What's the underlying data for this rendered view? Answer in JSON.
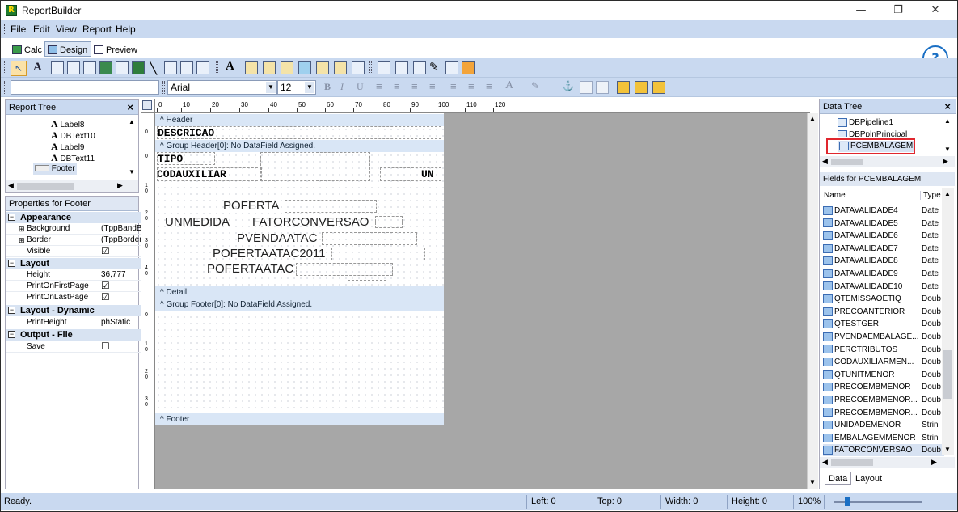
{
  "window": {
    "title": "ReportBuilder",
    "icon_letter": "R",
    "min": "—",
    "restore": "❐",
    "close": "✕"
  },
  "menu": [
    "File",
    "Edit",
    "View",
    "Report",
    "Help"
  ],
  "tabs": [
    "Calc",
    "Design",
    "Preview"
  ],
  "font": {
    "name": "Arial",
    "size": "12"
  },
  "report_tree": {
    "title": "Report Tree",
    "items": [
      "Label8",
      "DBText10",
      "Label9",
      "DBText11",
      "Footer"
    ]
  },
  "properties": {
    "title": "Properties for Footer",
    "categories": [
      {
        "name": "Appearance",
        "rows": [
          {
            "name": "Background",
            "value": "(TppBandBa",
            "expand": "⊞"
          },
          {
            "name": "Border",
            "value": "(TppBorder",
            "expand": "⊞"
          },
          {
            "name": "Visible",
            "value": "☑"
          }
        ]
      },
      {
        "name": "Layout",
        "rows": [
          {
            "name": "Height",
            "value": "36,777"
          },
          {
            "name": "PrintOnFirstPage",
            "value": "☑"
          },
          {
            "name": "PrintOnLastPage",
            "value": "☑"
          }
        ]
      },
      {
        "name": "Layout - Dynamic",
        "rows": [
          {
            "name": "PrintHeight",
            "value": "phStatic"
          }
        ]
      },
      {
        "name": "Output - File",
        "rows": [
          {
            "name": "Save",
            "value": "☐"
          }
        ]
      }
    ]
  },
  "ruler": [
    "0",
    "10",
    "20",
    "30",
    "40",
    "50",
    "60",
    "70",
    "80",
    "90",
    "100",
    "110",
    "120"
  ],
  "design": {
    "bands": {
      "header": "^ Header",
      "group_header": "^ Group Header[0]: No DataField Assigned.",
      "detail": "^ Detail",
      "group_footer": "^ Group Footer[0]: No DataField Assigned.",
      "footer": "^ Footer"
    },
    "descricao": "DESCRICAO",
    "tipo": "TIPO",
    "codauxiliar": "CODAUXILIAR",
    "un": "UN",
    "poferta": "POFERTA",
    "unmedida": "UNMEDIDA",
    "fatorconversao": "FATORCONVERSAO",
    "pvendaatac": "PVENDAATAC",
    "pofertaatac2011": "POFERTAATAC2011",
    "pofertaatac": "POFERTAATAC"
  },
  "data_tree": {
    "title": "Data Tree",
    "pipelines": [
      "DBPipeline1",
      "DBPplnPrincipal",
      "PCEMBALAGEM"
    ],
    "selected": "PCEMBALAGEM",
    "fields_title": "Fields for PCEMBALAGEM",
    "col_name": "Name",
    "col_type": "Type",
    "fields": [
      {
        "name": "DATAVALIDADE4",
        "type": "Date"
      },
      {
        "name": "DATAVALIDADE5",
        "type": "Date"
      },
      {
        "name": "DATAVALIDADE6",
        "type": "Date"
      },
      {
        "name": "DATAVALIDADE7",
        "type": "Date"
      },
      {
        "name": "DATAVALIDADE8",
        "type": "Date"
      },
      {
        "name": "DATAVALIDADE9",
        "type": "Date"
      },
      {
        "name": "DATAVALIDADE10",
        "type": "Date"
      },
      {
        "name": "QTEMISSAOETIQ",
        "type": "Doub"
      },
      {
        "name": "PRECOANTERIOR",
        "type": "Doub"
      },
      {
        "name": "QTESTGER",
        "type": "Doub"
      },
      {
        "name": "PVENDAEMBALAGE...",
        "type": "Doub"
      },
      {
        "name": "PERCTRIBUTOS",
        "type": "Doub"
      },
      {
        "name": "CODAUXILIARMEN...",
        "type": "Doub"
      },
      {
        "name": "QTUNITMENOR",
        "type": "Doub"
      },
      {
        "name": "PRECOEMBMENOR",
        "type": "Doub"
      },
      {
        "name": "PRECOEMBMENOR...",
        "type": "Doub"
      },
      {
        "name": "PRECOEMBMENOR...",
        "type": "Doub"
      },
      {
        "name": "UNIDADEMENOR",
        "type": "Strin"
      },
      {
        "name": "EMBALAGEMMENOR",
        "type": "Strin"
      },
      {
        "name": "FATORCONVERSAO",
        "type": "Doub"
      }
    ],
    "bottom_tabs": [
      "Data",
      "Layout"
    ]
  },
  "status": {
    "text": "Ready.",
    "left": "Left: 0",
    "top": "Top: 0",
    "width": "Width: 0",
    "height": "Height: 0",
    "zoom": "100%"
  },
  "colors": {
    "accent": "#c9d9f0",
    "highlight_box": "#e0262e",
    "band": "#d9e6f6"
  }
}
